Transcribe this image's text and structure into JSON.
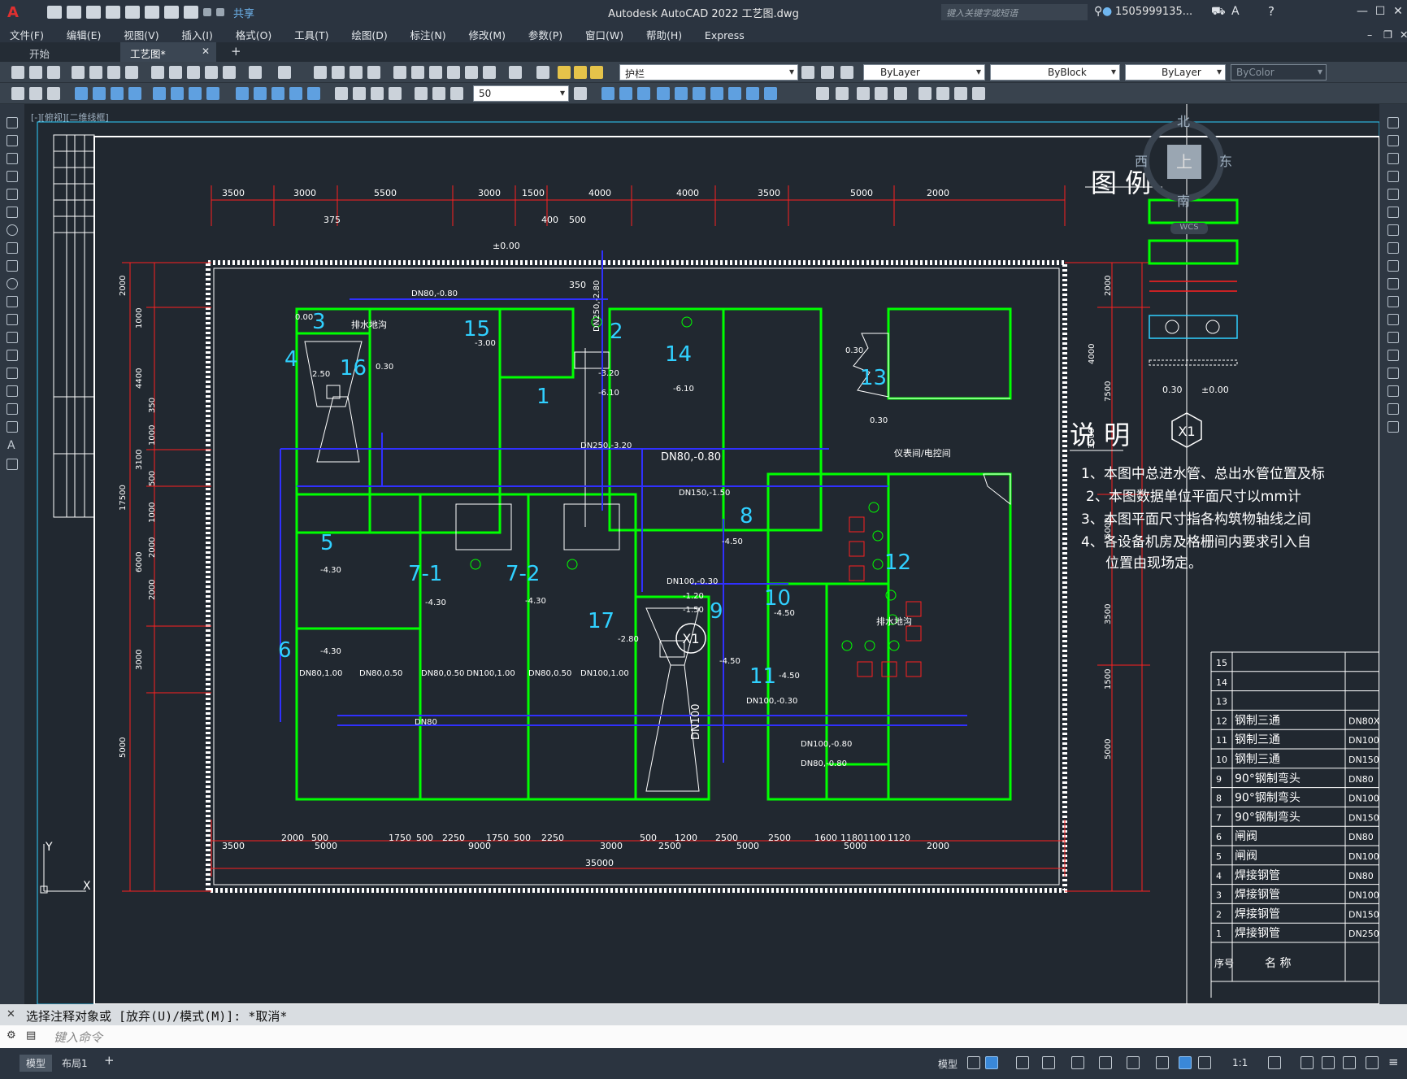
{
  "title_bar": {
    "app_title": "Autodesk AutoCAD 2022    工艺图.dwg",
    "share_label": "共享",
    "search_placeholder": "键入关键字或短语",
    "user_name": "1505999135...",
    "help_icon": "question-icon"
  },
  "menu": [
    "文件(F)",
    "编辑(E)",
    "视图(V)",
    "插入(I)",
    "格式(O)",
    "工具(T)",
    "绘图(D)",
    "标注(N)",
    "修改(M)",
    "参数(P)",
    "窗口(W)",
    "帮助(H)",
    "Express"
  ],
  "tabs": [
    {
      "label": "开始"
    },
    {
      "label": "工艺图*"
    }
  ],
  "toolbar": {
    "layer_value": "护栏",
    "color_value": "ByLayer",
    "linetype_value": "ByBlock",
    "lineweight_value": "ByLayer",
    "plotstyle_value": "ByColor",
    "dimstyle_value": "50"
  },
  "viewport_label": "[-][俯视][二维线框]",
  "viewcube": {
    "north": "北",
    "south": "南",
    "east": "东",
    "west": "西",
    "top": "上",
    "ucs": "WCS"
  },
  "command": {
    "history": "选择注释对象或 [放弃(U)/模式(M)]: *取消*",
    "placeholder": "键入命令"
  },
  "status": {
    "model_tab": "模型",
    "layout_tab": "布局1",
    "model_label": "模型",
    "scale": "1:1"
  },
  "drawing": {
    "legend_title": "图 例",
    "notes_title": "说 明",
    "x1_label": "X1",
    "notes": [
      "1、本图中总进水管、总出水管位置及标",
      "2、本图数据单位平面尺寸以mm计",
      "3、本图平面尺寸指各构筑物轴线之间",
      "4、各设备机房及格栅间内要求引入自",
      "位置由现场定。"
    ],
    "legend_values": [
      "0.30",
      "±0.00"
    ],
    "table_rows": [
      {
        "no": "15",
        "name": "",
        "spec": ""
      },
      {
        "no": "14",
        "name": "",
        "spec": ""
      },
      {
        "no": "13",
        "name": "",
        "spec": ""
      },
      {
        "no": "12",
        "name": "钢制三通",
        "spec": "DN80X"
      },
      {
        "no": "11",
        "name": "钢制三通",
        "spec": "DN100"
      },
      {
        "no": "10",
        "name": "钢制三通",
        "spec": "DN150"
      },
      {
        "no": "9",
        "name": "90°钢制弯头",
        "spec": "DN80"
      },
      {
        "no": "8",
        "name": "90°钢制弯头",
        "spec": "DN100"
      },
      {
        "no": "7",
        "name": "90°钢制弯头",
        "spec": "DN150"
      },
      {
        "no": "6",
        "name": "闸阀",
        "spec": "DN80"
      },
      {
        "no": "5",
        "name": "闸阀",
        "spec": "DN100"
      },
      {
        "no": "4",
        "name": "焊接钢管",
        "spec": "DN80"
      },
      {
        "no": "3",
        "name": "焊接钢管",
        "spec": "DN100"
      },
      {
        "no": "2",
        "name": "焊接钢管",
        "spec": "DN150"
      },
      {
        "no": "1",
        "name": "焊接钢管",
        "spec": "DN250"
      }
    ],
    "table_footer": {
      "no": "序号",
      "name": "名 称"
    },
    "top_dims": [
      "3500",
      "3000",
      "5500",
      "3000",
      "1500",
      "4000",
      "4000",
      "3500",
      "5000",
      "2000"
    ],
    "bottom_dims": [
      "3500",
      "2000",
      "500",
      "5000",
      "1750",
      "500",
      "2250",
      "9000",
      "1750",
      "500",
      "2250",
      "3000",
      "500",
      "1200",
      "2500",
      "2500",
      "1600",
      "1180",
      "1100",
      "1120",
      "2000",
      "5000",
      "5000",
      "2500"
    ],
    "total_dim": "35000",
    "left_dims": [
      "2000",
      "1000",
      "4400",
      "350",
      "1000",
      "3100",
      "500",
      "1000",
      "2000",
      "17500",
      "6000",
      "2000",
      "3000",
      "5000"
    ],
    "right_dims": [
      "2000",
      "4000",
      "7500",
      "3500",
      "5000",
      "3500",
      "1500",
      "5000"
    ],
    "rooms": [
      {
        "id": "3",
        "level": "0.00"
      },
      {
        "id": "4",
        "level": "2.50"
      },
      {
        "id": "16",
        "level": "0.30"
      },
      {
        "id": "15",
        "level": "-3.00"
      },
      {
        "id": "1",
        "level": "-3.20"
      },
      {
        "id": "2",
        "level": "-6.10"
      },
      {
        "id": "14",
        "level": "-6.10"
      },
      {
        "id": "13",
        "level": "0.30"
      },
      {
        "id": "5",
        "level": "-4.30"
      },
      {
        "id": "6",
        "level": "-4.30"
      },
      {
        "id": "7-1",
        "level": "-4.30"
      },
      {
        "id": "7-2",
        "level": "-4.30"
      },
      {
        "id": "17",
        "level": "-2.80"
      },
      {
        "id": "8",
        "level": "-4.50"
      },
      {
        "id": "9",
        "level": "-4.50"
      },
      {
        "id": "10",
        "level": "-4.50"
      },
      {
        "id": "11",
        "level": "-4.50"
      },
      {
        "id": "12",
        "level": "0.30"
      }
    ],
    "labels": {
      "pipe_top": "DN80,-0.80",
      "drain_1": "排水地沟",
      "drain_2": "排水地沟",
      "instrument": "仪表间/电控间",
      "dn250": "DN250,-2.80",
      "dn250b": "DN250,-3.20",
      "dn80c": "DN80,-0.80",
      "dn150": "DN150,-1.50",
      "dn100v": "DN100",
      "dn80bot": "DN80",
      "dn100a": "DN100,-0.30",
      "dn100b": "DN100,-0.80",
      "dn80d": "DN80,-0.80",
      "dn100c": "DN100,-0.30",
      "level_00": "±0.00",
      "dim_375": "375",
      "dim_400": "400",
      "dim_500": "500",
      "dim_350": "350",
      "dn_1": "DN80,1.00",
      "dn_2": "DN80,0.50",
      "dn_3": "DN80,0.50",
      "dn_4": "DN100,1.00",
      "dn_5": "DN80,0.50",
      "dn_6": "DN100,1.00",
      "e120": "-1.20",
      "e150": "-1.50"
    }
  },
  "colors": {
    "room_outline": "#00ff00",
    "dimension": "#ff2020",
    "pipe": "#3030ff",
    "text_cyan": "#30d0ff",
    "text_white": "#ffffff",
    "background": "#212830"
  }
}
